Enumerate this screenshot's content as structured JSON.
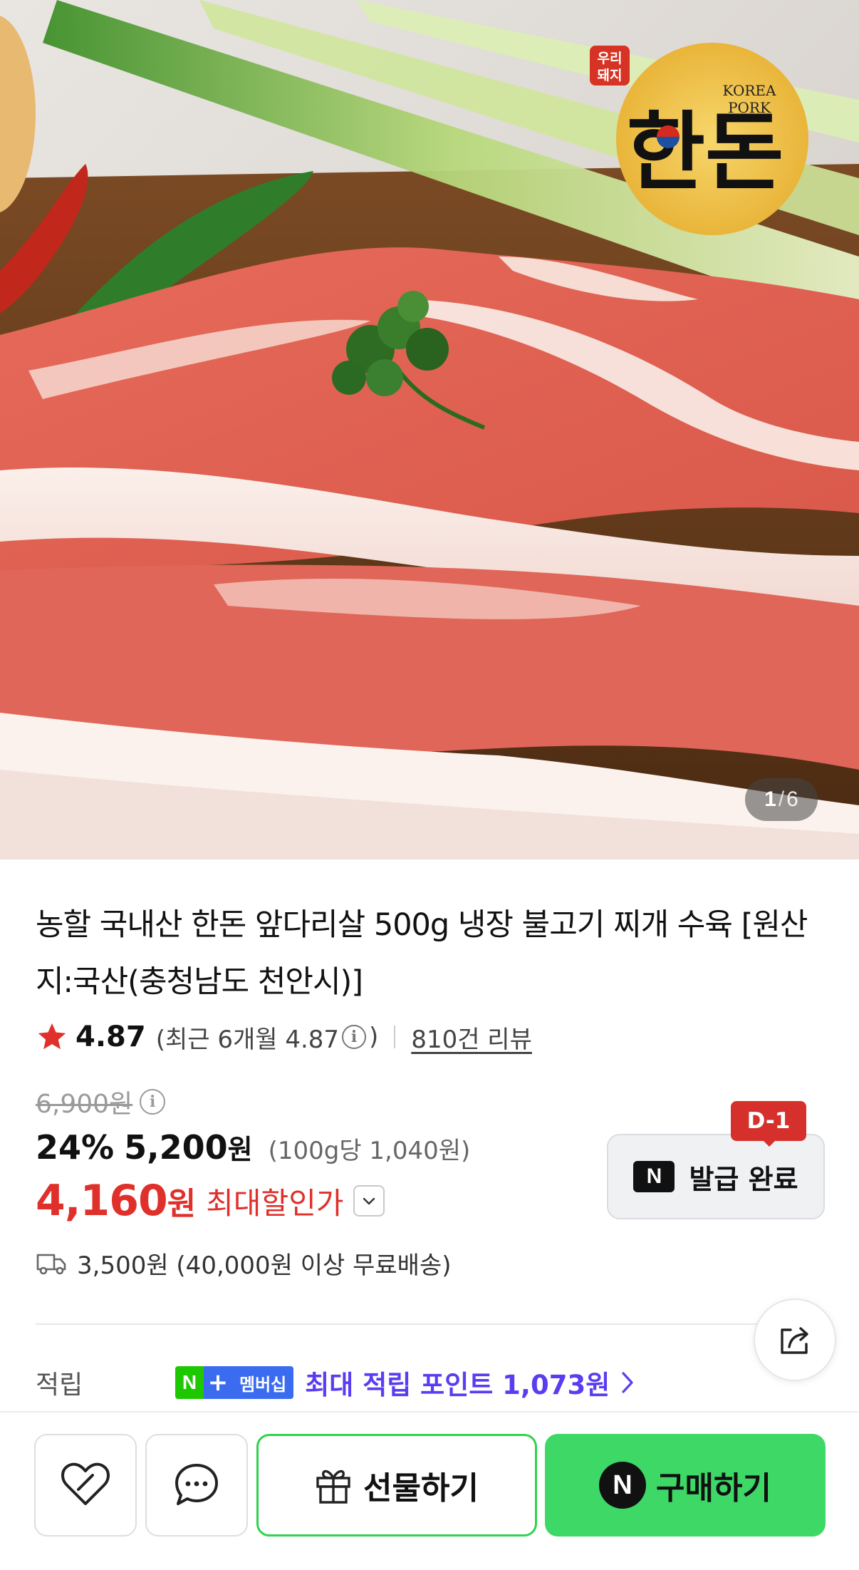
{
  "gallery": {
    "current": "1",
    "separator": "/",
    "total": "6",
    "logo_badge": "우리\n돼지",
    "logo_brand_en_line1": "KOREA",
    "logo_brand_en_line2": "PORK",
    "logo_brand_ko": "한돈"
  },
  "product": {
    "title": "농할 국내산 한돈 앞다리살 500g 냉장 불고기 찌개 수육 [원산지:국산(충청남도 천안시)]"
  },
  "rating": {
    "score": "4.87",
    "recent_prefix": "(최근 6개월 4.87",
    "recent_suffix": ")",
    "info_icon": "i",
    "reviews": "810건 리뷰"
  },
  "price": {
    "original": "6,900원",
    "discount_pct": "24%",
    "sale": "5,200",
    "sale_won": "원",
    "unit": "(100g당 1,040원)",
    "max": "4,160",
    "max_won": "원",
    "max_label": "최대할인가"
  },
  "coupon": {
    "dday": "D-1",
    "n_badge": "N",
    "label": "발급 완료"
  },
  "shipping": {
    "text": "3,500원 (40,000원 이상 무료배송)"
  },
  "points": {
    "label": "적립",
    "badge_n": "N",
    "badge_plus": "+",
    "badge_text": "멤버십",
    "text": "최대 적립 포인트 1,073원"
  },
  "actions": {
    "gift_label": "선물하기",
    "buy_n": "N",
    "buy_label": "구매하기"
  },
  "colors": {
    "sale_red": "#e0302b",
    "buy_green": "#3ed867",
    "points_purple": "#5a3df0"
  }
}
